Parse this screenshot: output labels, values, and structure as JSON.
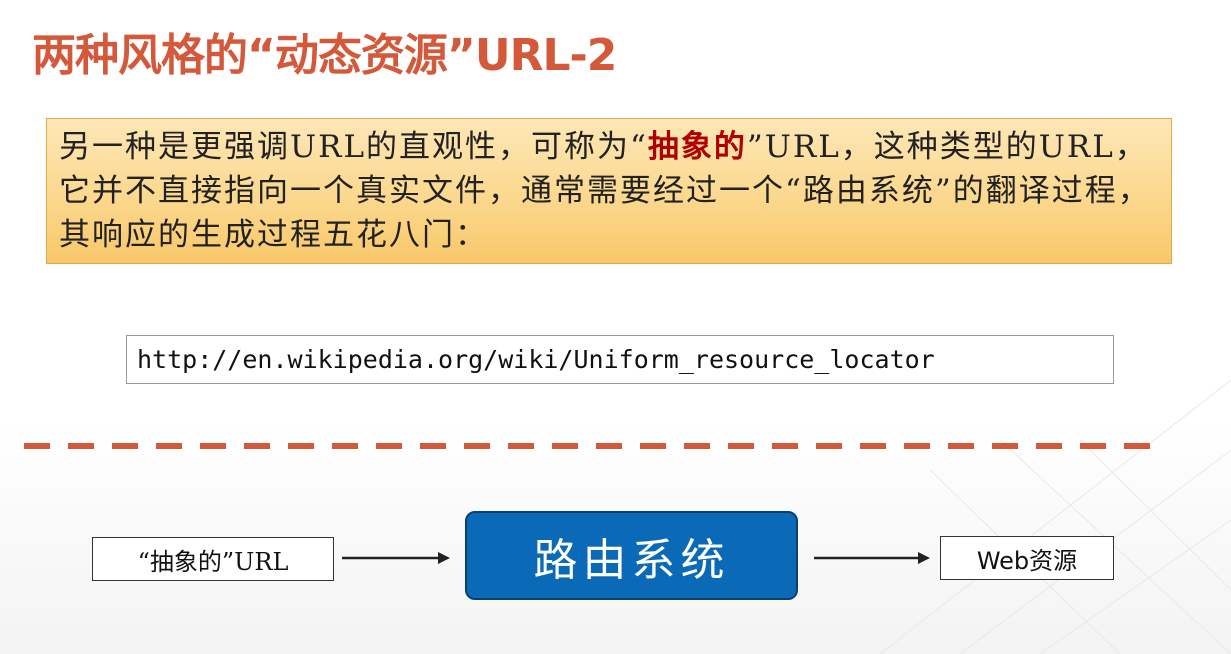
{
  "title": "两种风格的“动态资源”URL-2",
  "description": {
    "before": "另一种是更强调URL的直观性，可称为“",
    "highlight": "抽象的",
    "after": "”URL，这种类型的URL，它并不直接指向一个真实文件，通常需要经过一个“路由系统”的翻译过程，其响应的生成过程五花八门："
  },
  "example_url": "http://en.wikipedia.org/wiki/Uniform_resource_locator",
  "flow": {
    "input_label": "“抽象的”URL",
    "router_label": "路由系统",
    "output_label": "Web资源"
  },
  "colors": {
    "title": "#d4583a",
    "highlight": "#b00000",
    "router_fill": "#0a6ab8",
    "divider": "#d4583a",
    "box_fill_top": "#fde7b7",
    "box_fill_bottom": "#f8c86a"
  },
  "icons": {
    "arrow_1": "right-arrow-icon",
    "arrow_2": "right-arrow-icon"
  }
}
